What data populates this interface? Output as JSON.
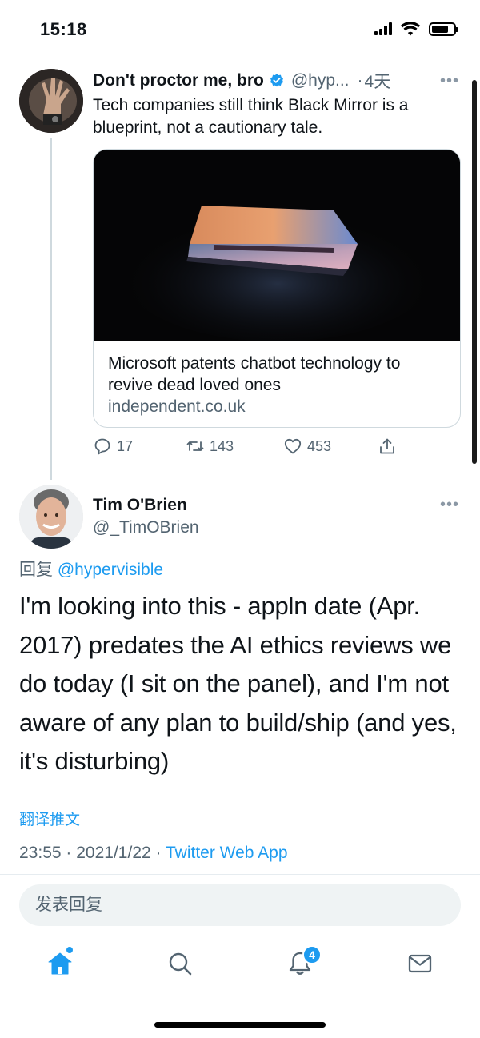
{
  "status_bar": {
    "time": "15:18",
    "icons": [
      "signal-icon",
      "wifi-icon",
      "battery-icon"
    ]
  },
  "tweet_quoted": {
    "name": "Don't proctor me, bro",
    "handle": "@hyp...",
    "separator": "·",
    "time": "4天",
    "more": "•••",
    "text": "Tech companies still think Black Mirror is a blueprint, not a cautionary tale.",
    "card": {
      "title": "Microsoft patents chatbot technology to revive dead loved ones",
      "domain": "independent.co.uk"
    },
    "actions": {
      "replies": "17",
      "retweets": "143",
      "likes": "453"
    }
  },
  "tweet_main": {
    "name": "Tim O'Brien",
    "handle": "@_TimOBrien",
    "more": "•••",
    "reply_prefix": "回复",
    "reply_mention": "@hypervisible",
    "text": "I'm looking into this - appln date (Apr. 2017) predates the AI ethics reviews we do today (I sit on the panel), and I'm not aware of any plan to build/ship (and yes, it's disturbing)",
    "translate": "翻译推文",
    "time": "23:55",
    "sep1": "·",
    "date": "2021/1/22",
    "sep2": "·",
    "source": "Twitter Web App"
  },
  "reply_box": {
    "placeholder": "发表回复"
  },
  "tab_bar": {
    "notification_count": "4"
  },
  "colors": {
    "accent": "#1d9bf0",
    "text": "#0f1419",
    "secondary": "#536471",
    "border": "#cfd9de"
  }
}
